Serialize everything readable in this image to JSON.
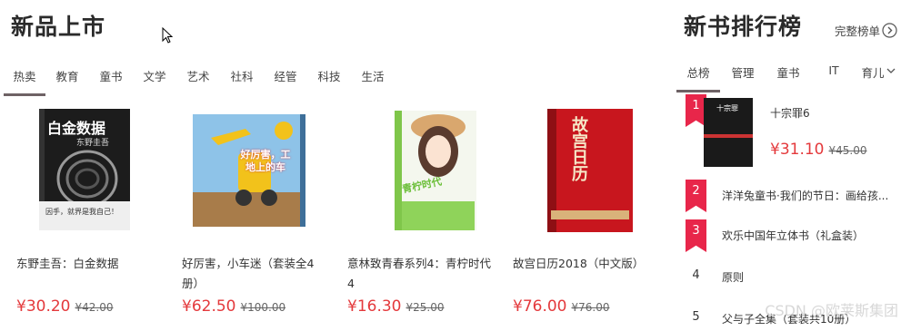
{
  "new_arrivals": {
    "title": "新品上市",
    "tabs": [
      "热卖",
      "教育",
      "童书",
      "文学",
      "艺术",
      "社科",
      "经管",
      "科技",
      "生活"
    ],
    "products": [
      {
        "name": "东野圭吾：白金数据",
        "price": "¥30.20",
        "old_price": "¥42.00",
        "cover_title": "白金数据",
        "cover_sub": "东野圭吾",
        "cover_caption": "因手，就界是我自己！"
      },
      {
        "name": "好厉害，小车迷（套装全4册）",
        "price": "¥62.50",
        "old_price": "¥100.00",
        "cover_title": "好厉害，工地上的车"
      },
      {
        "name": "意林致青春系列4：青柠时代4",
        "price": "¥16.30",
        "old_price": "¥25.00",
        "cover_title": "青柠时代"
      },
      {
        "name": "故宫日历2018（中文版）",
        "price": "¥76.00",
        "old_price": "¥76.00",
        "cover_title": "故宫日历"
      }
    ]
  },
  "rankings": {
    "title": "新书排行榜",
    "more_label": "完整榜单",
    "tabs": [
      "总榜",
      "管理",
      "童书",
      "IT",
      "育儿"
    ],
    "items": [
      {
        "rank": "1",
        "name": "十宗罪6",
        "price": "¥31.10",
        "old_price": "¥45.00",
        "cover_title": "十宗罪"
      },
      {
        "rank": "2",
        "name": "洋洋兔童书·我们的节日：画给孩..."
      },
      {
        "rank": "3",
        "name": "欢乐中国年立体书（礼盒装）"
      },
      {
        "rank": "4",
        "name": "原则"
      },
      {
        "rank": "5",
        "name": "父与子全集（套装共10册）"
      }
    ]
  },
  "watermark": "CSDN @欧莱斯集团",
  "colors": {
    "accent": "#e8264a",
    "price": "#e4393c",
    "tab_underline": "#6e6265"
  }
}
